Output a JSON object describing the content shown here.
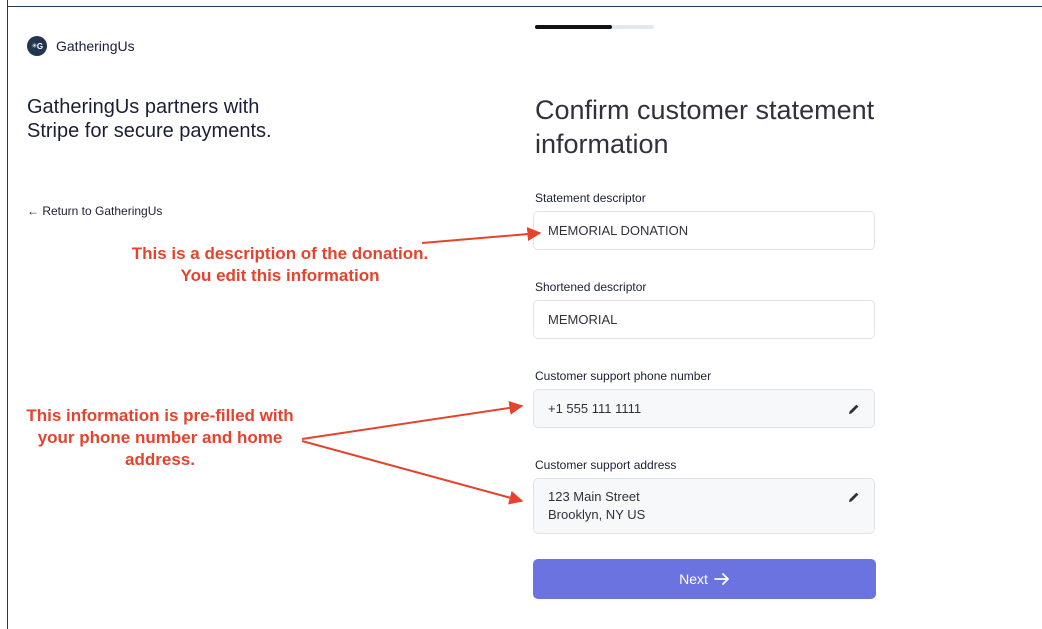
{
  "brand": {
    "name": "GatheringUs",
    "logo_text": "G"
  },
  "sidebar": {
    "partner_text": "GatheringUs partners with Stripe for secure payments.",
    "return_link": "← Return to GatheringUs"
  },
  "progress": {
    "fraction": 0.65
  },
  "form": {
    "heading": "Confirm customer statement information",
    "statement_descriptor": {
      "label": "Statement descriptor",
      "value": "MEMORIAL DONATION"
    },
    "shortened_descriptor": {
      "label": "Shortened descriptor",
      "value": "MEMORIAL"
    },
    "support_phone": {
      "label": "Customer support phone number",
      "value": "+1 555 111 1111",
      "edit_icon": "pencil-icon"
    },
    "support_address": {
      "label": "Customer support address",
      "line1": "123 Main Street",
      "line2": "Brooklyn, NY US",
      "edit_icon": "pencil-icon"
    },
    "next_label": "Next",
    "next_icon": "arrow-right-icon"
  },
  "annotations": {
    "description_note": "This is a description of the donation. You edit this information",
    "prefilled_note": "This information is pre-filled with your phone number and home address."
  },
  "colors": {
    "accent": "#6b73e0",
    "annotation": "#e5432d"
  }
}
